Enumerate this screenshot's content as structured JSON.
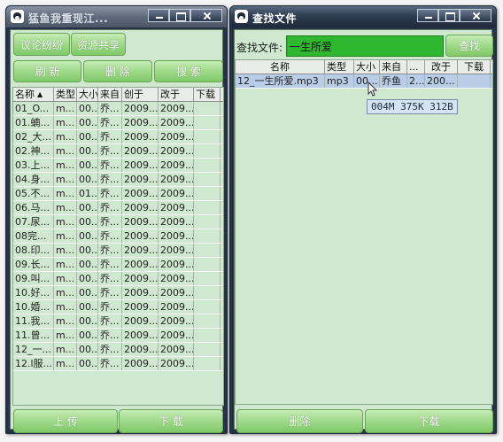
{
  "left_window": {
    "title": "猛鱼我重现江...",
    "tabs": [
      {
        "label": "议论纷纷"
      },
      {
        "label": "资源共享"
      }
    ],
    "actions": [
      {
        "label": "刷 新"
      },
      {
        "label": "删 除"
      },
      {
        "label": "搜 索"
      }
    ],
    "columns": [
      "名称",
      "类型",
      "大小",
      "来自",
      "创于",
      "改于",
      "下载"
    ],
    "rows": [
      [
        "01_O...",
        "m...",
        "00...",
        "乔...",
        "2009...",
        "2009..."
      ],
      [
        "01.蝻...",
        "m...",
        "00...",
        "乔...",
        "2009...",
        "2009..."
      ],
      [
        "02_大...",
        "m...",
        "00...",
        "乔...",
        "2009...",
        "2009..."
      ],
      [
        "02.神...",
        "m...",
        "00...",
        "乔...",
        "2009...",
        "2009..."
      ],
      [
        "03.上...",
        "m...",
        "00...",
        "乔...",
        "2009...",
        "2009..."
      ],
      [
        "04.身...",
        "m...",
        "00...",
        "乔...",
        "2009...",
        "2009..."
      ],
      [
        "05.不...",
        "m...",
        "01...",
        "乔...",
        "2009...",
        "2009..."
      ],
      [
        "06.马...",
        "m...",
        "00...",
        "乔...",
        "2009...",
        "2009..."
      ],
      [
        "07.尿...",
        "m...",
        "00...",
        "乔...",
        "2009...",
        "2009..."
      ],
      [
        "08完...",
        "m...",
        "00...",
        "乔...",
        "2009...",
        "2009..."
      ],
      [
        "08.印...",
        "m...",
        "00...",
        "乔...",
        "2009...",
        "2009..."
      ],
      [
        "09.长...",
        "m...",
        "00...",
        "乔...",
        "2009...",
        "2009..."
      ],
      [
        "09.叫...",
        "m...",
        "00...",
        "乔...",
        "2009...",
        "2009..."
      ],
      [
        "10.好...",
        "m...",
        "00...",
        "乔...",
        "2009...",
        "2009..."
      ],
      [
        "10.婚...",
        "m...",
        "00...",
        "乔...",
        "2009...",
        "2009..."
      ],
      [
        "11.我...",
        "m...",
        "00...",
        "乔...",
        "2009...",
        "2009..."
      ],
      [
        "11.曾...",
        "m...",
        "00...",
        "乔...",
        "2009...",
        "2009..."
      ],
      [
        "12_一...",
        "m...",
        "00...",
        "乔...",
        "2009...",
        "2009..."
      ],
      [
        "12.l服...",
        "m...",
        "00...",
        "乔...",
        "2009...",
        "2009..."
      ]
    ],
    "bottom": [
      {
        "label": "上 传"
      },
      {
        "label": "下 载"
      }
    ]
  },
  "right_window": {
    "title": "查找文件",
    "search_label": "查找文件:",
    "search_value": "一生所爱",
    "search_button": "查找",
    "columns": [
      "名称",
      "类型",
      "大小",
      "来自",
      "...",
      "改于",
      "下载"
    ],
    "rows": [
      [
        "12_一生所爱.mp3",
        "mp3",
        "00...",
        "乔鱼",
        "2...",
        "200...",
        ""
      ]
    ],
    "tooltip": "004M 375K 312B",
    "bottom": [
      {
        "label": "删除"
      },
      {
        "label": "下载"
      }
    ]
  },
  "colors": {
    "panel_bg": "#cfe8cf",
    "button_green": "#9fd98a",
    "search_field": "#2fb82f",
    "selected_row": "#b9cde8",
    "titlebar": "#2f3d52"
  },
  "icons": [
    "penguin-app-icon",
    "minimize-icon",
    "maximize-icon",
    "close-icon",
    "sort-ascending-icon",
    "mouse-cursor-icon"
  ]
}
